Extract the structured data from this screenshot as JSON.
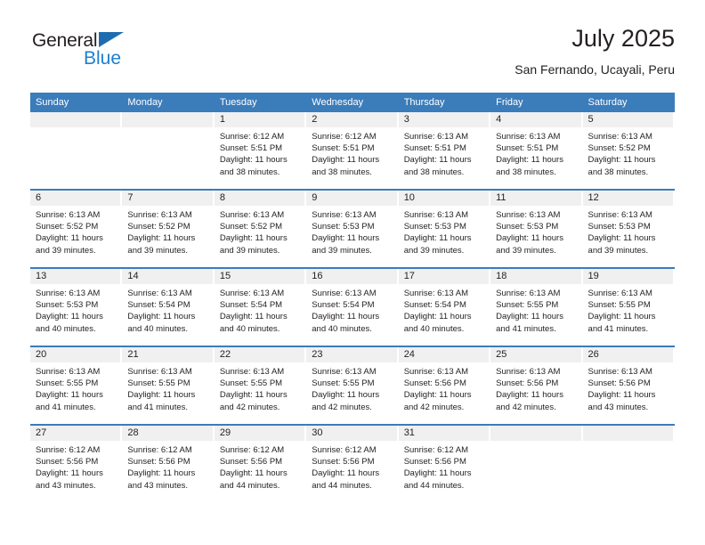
{
  "logo": {
    "word1": "General",
    "word2": "Blue",
    "triangle_color": "#1d6cb0",
    "blue_text_color": "#1d7fd0"
  },
  "header": {
    "month_title": "July 2025",
    "location": "San Fernando, Ucayali, Peru"
  },
  "theme": {
    "header_blue": "#3b7cba",
    "daynum_band": "#f0f0f0",
    "text": "#231f20"
  },
  "calendar": {
    "weekday_headers": [
      "Sunday",
      "Monday",
      "Tuesday",
      "Wednesday",
      "Thursday",
      "Friday",
      "Saturday"
    ],
    "weeks": [
      [
        {
          "date": "",
          "sunrise": "",
          "sunset": "",
          "daylight_line1": "",
          "daylight_line2": ""
        },
        {
          "date": "",
          "sunrise": "",
          "sunset": "",
          "daylight_line1": "",
          "daylight_line2": ""
        },
        {
          "date": "1",
          "sunrise": "Sunrise: 6:12 AM",
          "sunset": "Sunset: 5:51 PM",
          "daylight_line1": "Daylight: 11 hours",
          "daylight_line2": "and 38 minutes."
        },
        {
          "date": "2",
          "sunrise": "Sunrise: 6:12 AM",
          "sunset": "Sunset: 5:51 PM",
          "daylight_line1": "Daylight: 11 hours",
          "daylight_line2": "and 38 minutes."
        },
        {
          "date": "3",
          "sunrise": "Sunrise: 6:13 AM",
          "sunset": "Sunset: 5:51 PM",
          "daylight_line1": "Daylight: 11 hours",
          "daylight_line2": "and 38 minutes."
        },
        {
          "date": "4",
          "sunrise": "Sunrise: 6:13 AM",
          "sunset": "Sunset: 5:51 PM",
          "daylight_line1": "Daylight: 11 hours",
          "daylight_line2": "and 38 minutes."
        },
        {
          "date": "5",
          "sunrise": "Sunrise: 6:13 AM",
          "sunset": "Sunset: 5:52 PM",
          "daylight_line1": "Daylight: 11 hours",
          "daylight_line2": "and 38 minutes."
        }
      ],
      [
        {
          "date": "6",
          "sunrise": "Sunrise: 6:13 AM",
          "sunset": "Sunset: 5:52 PM",
          "daylight_line1": "Daylight: 11 hours",
          "daylight_line2": "and 39 minutes."
        },
        {
          "date": "7",
          "sunrise": "Sunrise: 6:13 AM",
          "sunset": "Sunset: 5:52 PM",
          "daylight_line1": "Daylight: 11 hours",
          "daylight_line2": "and 39 minutes."
        },
        {
          "date": "8",
          "sunrise": "Sunrise: 6:13 AM",
          "sunset": "Sunset: 5:52 PM",
          "daylight_line1": "Daylight: 11 hours",
          "daylight_line2": "and 39 minutes."
        },
        {
          "date": "9",
          "sunrise": "Sunrise: 6:13 AM",
          "sunset": "Sunset: 5:53 PM",
          "daylight_line1": "Daylight: 11 hours",
          "daylight_line2": "and 39 minutes."
        },
        {
          "date": "10",
          "sunrise": "Sunrise: 6:13 AM",
          "sunset": "Sunset: 5:53 PM",
          "daylight_line1": "Daylight: 11 hours",
          "daylight_line2": "and 39 minutes."
        },
        {
          "date": "11",
          "sunrise": "Sunrise: 6:13 AM",
          "sunset": "Sunset: 5:53 PM",
          "daylight_line1": "Daylight: 11 hours",
          "daylight_line2": "and 39 minutes."
        },
        {
          "date": "12",
          "sunrise": "Sunrise: 6:13 AM",
          "sunset": "Sunset: 5:53 PM",
          "daylight_line1": "Daylight: 11 hours",
          "daylight_line2": "and 39 minutes."
        }
      ],
      [
        {
          "date": "13",
          "sunrise": "Sunrise: 6:13 AM",
          "sunset": "Sunset: 5:53 PM",
          "daylight_line1": "Daylight: 11 hours",
          "daylight_line2": "and 40 minutes."
        },
        {
          "date": "14",
          "sunrise": "Sunrise: 6:13 AM",
          "sunset": "Sunset: 5:54 PM",
          "daylight_line1": "Daylight: 11 hours",
          "daylight_line2": "and 40 minutes."
        },
        {
          "date": "15",
          "sunrise": "Sunrise: 6:13 AM",
          "sunset": "Sunset: 5:54 PM",
          "daylight_line1": "Daylight: 11 hours",
          "daylight_line2": "and 40 minutes."
        },
        {
          "date": "16",
          "sunrise": "Sunrise: 6:13 AM",
          "sunset": "Sunset: 5:54 PM",
          "daylight_line1": "Daylight: 11 hours",
          "daylight_line2": "and 40 minutes."
        },
        {
          "date": "17",
          "sunrise": "Sunrise: 6:13 AM",
          "sunset": "Sunset: 5:54 PM",
          "daylight_line1": "Daylight: 11 hours",
          "daylight_line2": "and 40 minutes."
        },
        {
          "date": "18",
          "sunrise": "Sunrise: 6:13 AM",
          "sunset": "Sunset: 5:55 PM",
          "daylight_line1": "Daylight: 11 hours",
          "daylight_line2": "and 41 minutes."
        },
        {
          "date": "19",
          "sunrise": "Sunrise: 6:13 AM",
          "sunset": "Sunset: 5:55 PM",
          "daylight_line1": "Daylight: 11 hours",
          "daylight_line2": "and 41 minutes."
        }
      ],
      [
        {
          "date": "20",
          "sunrise": "Sunrise: 6:13 AM",
          "sunset": "Sunset: 5:55 PM",
          "daylight_line1": "Daylight: 11 hours",
          "daylight_line2": "and 41 minutes."
        },
        {
          "date": "21",
          "sunrise": "Sunrise: 6:13 AM",
          "sunset": "Sunset: 5:55 PM",
          "daylight_line1": "Daylight: 11 hours",
          "daylight_line2": "and 41 minutes."
        },
        {
          "date": "22",
          "sunrise": "Sunrise: 6:13 AM",
          "sunset": "Sunset: 5:55 PM",
          "daylight_line1": "Daylight: 11 hours",
          "daylight_line2": "and 42 minutes."
        },
        {
          "date": "23",
          "sunrise": "Sunrise: 6:13 AM",
          "sunset": "Sunset: 5:55 PM",
          "daylight_line1": "Daylight: 11 hours",
          "daylight_line2": "and 42 minutes."
        },
        {
          "date": "24",
          "sunrise": "Sunrise: 6:13 AM",
          "sunset": "Sunset: 5:56 PM",
          "daylight_line1": "Daylight: 11 hours",
          "daylight_line2": "and 42 minutes."
        },
        {
          "date": "25",
          "sunrise": "Sunrise: 6:13 AM",
          "sunset": "Sunset: 5:56 PM",
          "daylight_line1": "Daylight: 11 hours",
          "daylight_line2": "and 42 minutes."
        },
        {
          "date": "26",
          "sunrise": "Sunrise: 6:13 AM",
          "sunset": "Sunset: 5:56 PM",
          "daylight_line1": "Daylight: 11 hours",
          "daylight_line2": "and 43 minutes."
        }
      ],
      [
        {
          "date": "27",
          "sunrise": "Sunrise: 6:12 AM",
          "sunset": "Sunset: 5:56 PM",
          "daylight_line1": "Daylight: 11 hours",
          "daylight_line2": "and 43 minutes."
        },
        {
          "date": "28",
          "sunrise": "Sunrise: 6:12 AM",
          "sunset": "Sunset: 5:56 PM",
          "daylight_line1": "Daylight: 11 hours",
          "daylight_line2": "and 43 minutes."
        },
        {
          "date": "29",
          "sunrise": "Sunrise: 6:12 AM",
          "sunset": "Sunset: 5:56 PM",
          "daylight_line1": "Daylight: 11 hours",
          "daylight_line2": "and 44 minutes."
        },
        {
          "date": "30",
          "sunrise": "Sunrise: 6:12 AM",
          "sunset": "Sunset: 5:56 PM",
          "daylight_line1": "Daylight: 11 hours",
          "daylight_line2": "and 44 minutes."
        },
        {
          "date": "31",
          "sunrise": "Sunrise: 6:12 AM",
          "sunset": "Sunset: 5:56 PM",
          "daylight_line1": "Daylight: 11 hours",
          "daylight_line2": "and 44 minutes."
        },
        {
          "date": "",
          "sunrise": "",
          "sunset": "",
          "daylight_line1": "",
          "daylight_line2": ""
        },
        {
          "date": "",
          "sunrise": "",
          "sunset": "",
          "daylight_line1": "",
          "daylight_line2": ""
        }
      ]
    ]
  }
}
